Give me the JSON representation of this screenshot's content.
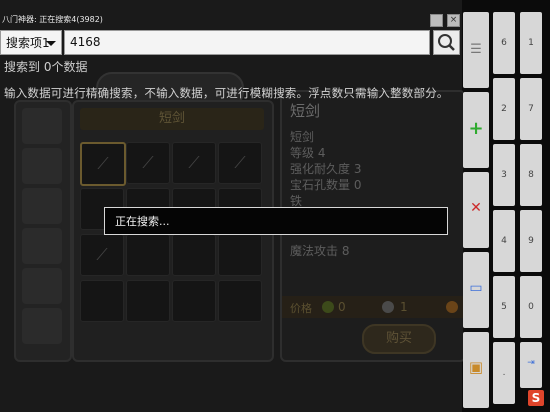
{
  "window": {
    "title": "八门神器: 正在搜索4(3982)",
    "minimize_label": "",
    "close_label": "×"
  },
  "search": {
    "dropdown_value": "搜索项1",
    "input_value": "4168",
    "result_text": "搜索到 0个数据",
    "hint_text": "输入数据可进行精确搜索，不输入数据，可进行模糊搜索。浮点数只需输入整数部分。"
  },
  "dialog": {
    "message": "正在搜索..."
  },
  "background_game": {
    "tab_label": "短剑",
    "category_label": "",
    "item_title": "短剑",
    "stats": [
      "短剑",
      "等级 4",
      "强化耐久度 3",
      "宝石孔数量 0",
      "铁",
      "魔法攻击 8"
    ],
    "price_label": "价格",
    "price_values": [
      "0",
      "1"
    ],
    "buy_label": "购买"
  },
  "toolbar": {
    "tools": [
      {
        "icon": "list-icon",
        "glyph": "☰",
        "color": "#777777"
      },
      {
        "icon": "plus-icon",
        "glyph": "+",
        "color": "#2eaa2e"
      },
      {
        "icon": "close-icon",
        "glyph": "✕",
        "color": "#cc2a2a"
      },
      {
        "icon": "keyboard-icon",
        "glyph": "▭",
        "color": "#3d6fd8"
      },
      {
        "icon": "settings-icon",
        "glyph": "▣",
        "color": "#c88a2a"
      }
    ],
    "keypad_left": [
      "1",
      "3",
      "4",
      "6",
      "7",
      "."
    ],
    "keypad_right": [
      "2",
      "3",
      "5",
      "0",
      "⇥"
    ]
  },
  "keypad": {
    "col1": [
      "6",
      "2",
      "3",
      "4",
      "5",
      "."
    ],
    "col2": [
      "1",
      "7",
      "8",
      "9",
      "0",
      "⇥"
    ]
  },
  "colors": {
    "background": "#0b0b0b",
    "input_bg": "#f4f4f4",
    "key_bg": "#d7d7d7",
    "logo": "#e0452b"
  }
}
